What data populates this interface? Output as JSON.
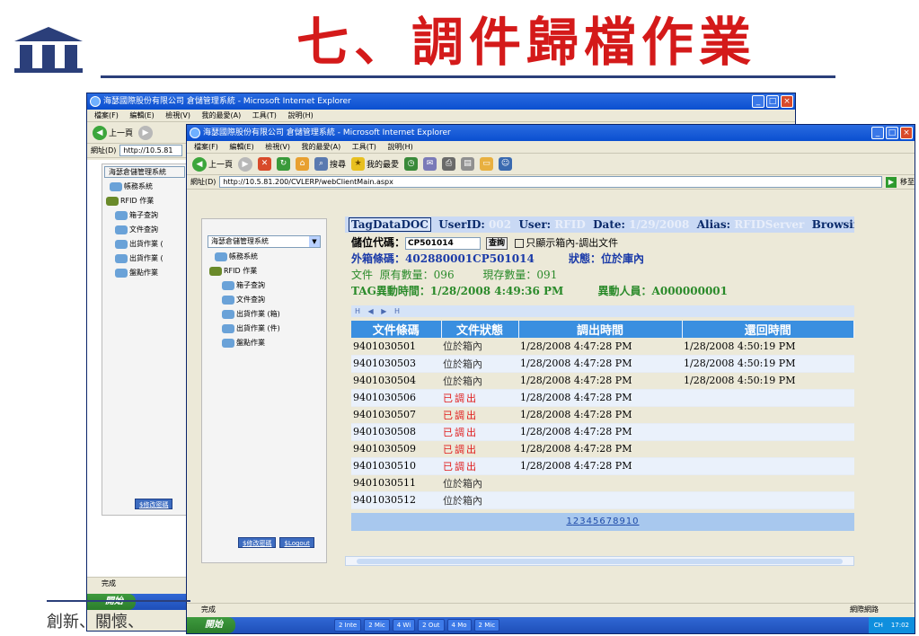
{
  "slide": {
    "title": "七、調件歸檔作業",
    "slogan": "創新、關懷、"
  },
  "back_window": {
    "title": "海瑟國際股份有限公司 倉儲管理系統 - Microsoft Internet Explorer",
    "menu": [
      "檔案(F)",
      "編輯(E)",
      "檢視(V)",
      "我的最愛(A)",
      "工具(T)",
      "說明(H)"
    ],
    "back_label": "上一頁",
    "address_label": "網址(D)",
    "address": "http://10.5.81",
    "tree_title": "海瑟倉儲管理系統",
    "tree": [
      "帳務系統",
      "RFID 作業",
      "箱子查詢",
      "文件查詢",
      "出貨作業 (",
      "出貨作業 (",
      "盤點作業"
    ],
    "nav_button": "$修改密碼",
    "status": "完成",
    "start_label": "開始"
  },
  "front_window": {
    "title": "海瑟國際股份有限公司 倉儲管理系統 - Microsoft Internet Explorer",
    "menu": [
      "檔案(F)",
      "編輯(E)",
      "檢視(V)",
      "我的最愛(A)",
      "工具(T)",
      "說明(H)"
    ],
    "back_label": "上一頁",
    "search_label": "搜尋",
    "favorites_label": "我的最愛",
    "address_label": "網址(D)",
    "address": "http://10.5.81.200/CVLERP/webClientMain.aspx",
    "go_label": "移至",
    "tree_title": "海瑟倉儲管理系統",
    "tree": [
      "帳務系統",
      "RFID 作業",
      "箱子查詢",
      "文件查詢",
      "出貨作業 (箱)",
      "出貨作業 (件)",
      "盤點作業"
    ],
    "nav_buttons": [
      "$修改密碼",
      "$Logout"
    ],
    "status": "完成",
    "zone": "網際網路",
    "start_label": "開始",
    "tasks": [
      "2 Inte",
      "2 Mic",
      "4 Wi",
      "2 Out",
      "4 Mo",
      "2 Mic"
    ],
    "tray_text": "CH",
    "clock": "17:02"
  },
  "header": {
    "app": "TagDataDOC",
    "userid_label": "UserID:",
    "userid": "002",
    "user_label": "User:",
    "user": "RFID",
    "date_label": "Date:",
    "date": "1/29/2008",
    "alias_label": "Alias:",
    "alias": "RFIDServer",
    "mode": "Browsing"
  },
  "info": {
    "storage_label": "儲位代碼：",
    "storage_value": "CP501014",
    "query_button": "查詢",
    "checkbox_label": "只顯示箱內-調出文件",
    "box_label": "外箱條碼：",
    "box_value": "402880001CP501014",
    "state_label": "狀態：",
    "state_value": "位於庫內",
    "doc_label": "文件",
    "orig_label": "原有數量：",
    "orig_value": "096",
    "curr_label": "現存數量：",
    "curr_value": "091",
    "tag_time_label": "TAG異動時間：",
    "tag_time": "1/28/2008 4:49:36 PM",
    "changer_label": "異動人員：",
    "changer": "A000000001"
  },
  "pager_top": "H ◀ ▶ H",
  "table": {
    "headers": [
      "文件條碼",
      "文件狀態",
      "調出時間",
      "還回時間"
    ],
    "rows": [
      {
        "code": "9401030501",
        "status": "位於箱內",
        "out": "1/28/2008 4:47:28 PM",
        "back": "1/28/2008 4:50:19 PM",
        "red": false
      },
      {
        "code": "9401030503",
        "status": "位於箱內",
        "out": "1/28/2008 4:47:28 PM",
        "back": "1/28/2008 4:50:19 PM",
        "red": false
      },
      {
        "code": "9401030504",
        "status": "位於箱內",
        "out": "1/28/2008 4:47:28 PM",
        "back": "1/28/2008 4:50:19 PM",
        "red": false
      },
      {
        "code": "9401030506",
        "status": "已調出",
        "out": "1/28/2008 4:47:28 PM",
        "back": "",
        "red": true
      },
      {
        "code": "9401030507",
        "status": "已調出",
        "out": "1/28/2008 4:47:28 PM",
        "back": "",
        "red": true
      },
      {
        "code": "9401030508",
        "status": "已調出",
        "out": "1/28/2008 4:47:28 PM",
        "back": "",
        "red": true
      },
      {
        "code": "9401030509",
        "status": "已調出",
        "out": "1/28/2008 4:47:28 PM",
        "back": "",
        "red": true
      },
      {
        "code": "9401030510",
        "status": "已調出",
        "out": "1/28/2008 4:47:28 PM",
        "back": "",
        "red": true
      },
      {
        "code": "9401030511",
        "status": "位於箱內",
        "out": "",
        "back": "",
        "red": false
      },
      {
        "code": "9401030512",
        "status": "位於箱內",
        "out": "",
        "back": "",
        "red": false
      }
    ]
  },
  "pages": [
    "1",
    "2",
    "3",
    "4",
    "5",
    "6",
    "7",
    "8",
    "9",
    "10"
  ],
  "colors": {
    "title_red": "#d41a1a",
    "header_blue": "#3a8fe0",
    "status_red": "#e01a1a",
    "info_green": "#2a8a2a",
    "info_blue": "#1a3aa8"
  }
}
